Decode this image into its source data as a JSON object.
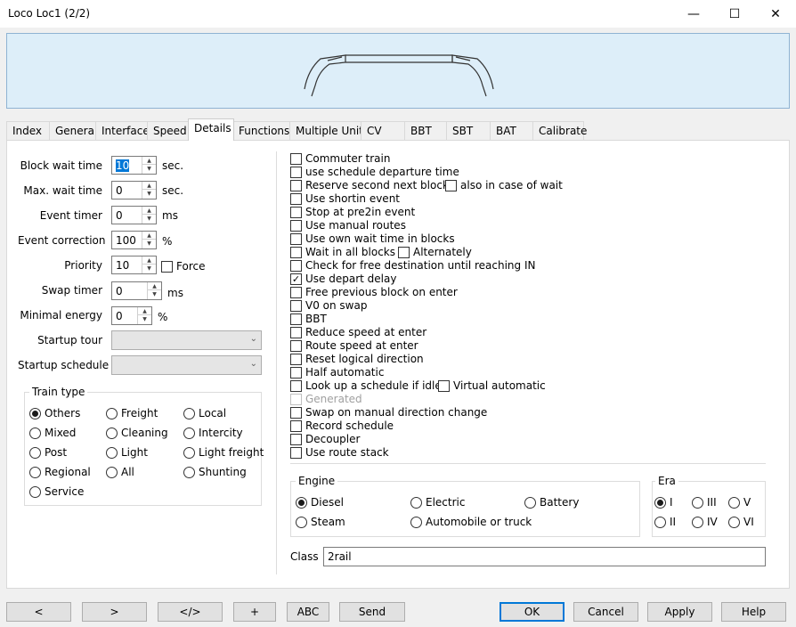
{
  "window": {
    "title": "Loco Loc1 (2/2)",
    "minimize": "—",
    "maximize": "☐",
    "close": "✕"
  },
  "tabs": [
    "Index",
    "General",
    "Interface",
    "Speed",
    "Details",
    "Functions",
    "Multiple Unit",
    "CV",
    "BBT",
    "SBT",
    "BAT",
    "Calibrate"
  ],
  "active_tab": "Details",
  "left": {
    "block_wait_time": {
      "label": "Block wait time",
      "value": "10",
      "unit": "sec."
    },
    "max_wait_time": {
      "label": "Max. wait time",
      "value": "0",
      "unit": "sec."
    },
    "event_timer": {
      "label": "Event timer",
      "value": "0",
      "unit": "ms"
    },
    "event_correction": {
      "label": "Event correction",
      "value": "100",
      "unit": "%"
    },
    "priority": {
      "label": "Priority",
      "value": "10",
      "force": "Force"
    },
    "swap_timer": {
      "label": "Swap timer",
      "value": "0",
      "unit": "ms"
    },
    "minimal_energy": {
      "label": "Minimal energy",
      "value": "0",
      "unit": "%"
    },
    "startup_tour": {
      "label": "Startup tour",
      "value": ""
    },
    "startup_schedule": {
      "label": "Startup schedule",
      "value": ""
    }
  },
  "train_type": {
    "title": "Train type",
    "options": [
      "Others",
      "Freight",
      "Local",
      "Mixed",
      "Cleaning",
      "Intercity",
      "Post",
      "Light",
      "Light freight",
      "Regional",
      "All",
      "Shunting",
      "Service"
    ],
    "selected": "Others"
  },
  "options": {
    "commuter": "Commuter train",
    "schedule_departure": "use schedule departure time",
    "reserve_second": "Reserve second next block.",
    "also_wait": "also in case of wait",
    "shortin": "Use shortin event",
    "stop_pre2in": "Stop at pre2in event",
    "manual_routes": "Use manual routes",
    "own_wait": "Use own wait time in blocks",
    "wait_all": "Wait in all blocks",
    "alternately": "Alternately",
    "check_free": "Check for free destination until reaching IN",
    "depart_delay": "Use depart delay",
    "free_previous": "Free previous block on enter",
    "v0_swap": "V0 on swap",
    "bbt": "BBT",
    "reduce_speed": "Reduce speed at enter",
    "route_speed": "Route speed at enter",
    "reset_direction": "Reset logical direction",
    "half_auto": "Half automatic",
    "lookup_schedule": "Look up a schedule if idle",
    "virtual_auto": "Virtual automatic",
    "generated": "Generated",
    "swap_manual": "Swap on manual direction change",
    "record_schedule": "Record schedule",
    "decoupler": "Decoupler",
    "route_stack": "Use route stack"
  },
  "engine": {
    "title": "Engine",
    "options": [
      "Diesel",
      "Electric",
      "Battery",
      "Steam",
      "Automobile or truck"
    ],
    "selected": "Diesel"
  },
  "era": {
    "title": "Era",
    "options": [
      "I",
      "III",
      "V",
      "II",
      "IV",
      "VI"
    ],
    "selected": "I"
  },
  "class": {
    "label": "Class",
    "value": "2rail"
  },
  "buttons": {
    "prev": "<",
    "next": ">",
    "code": "</>",
    "plus": "+",
    "abc": "ABC",
    "send": "Send",
    "ok": "OK",
    "cancel": "Cancel",
    "apply": "Apply",
    "help": "Help"
  }
}
